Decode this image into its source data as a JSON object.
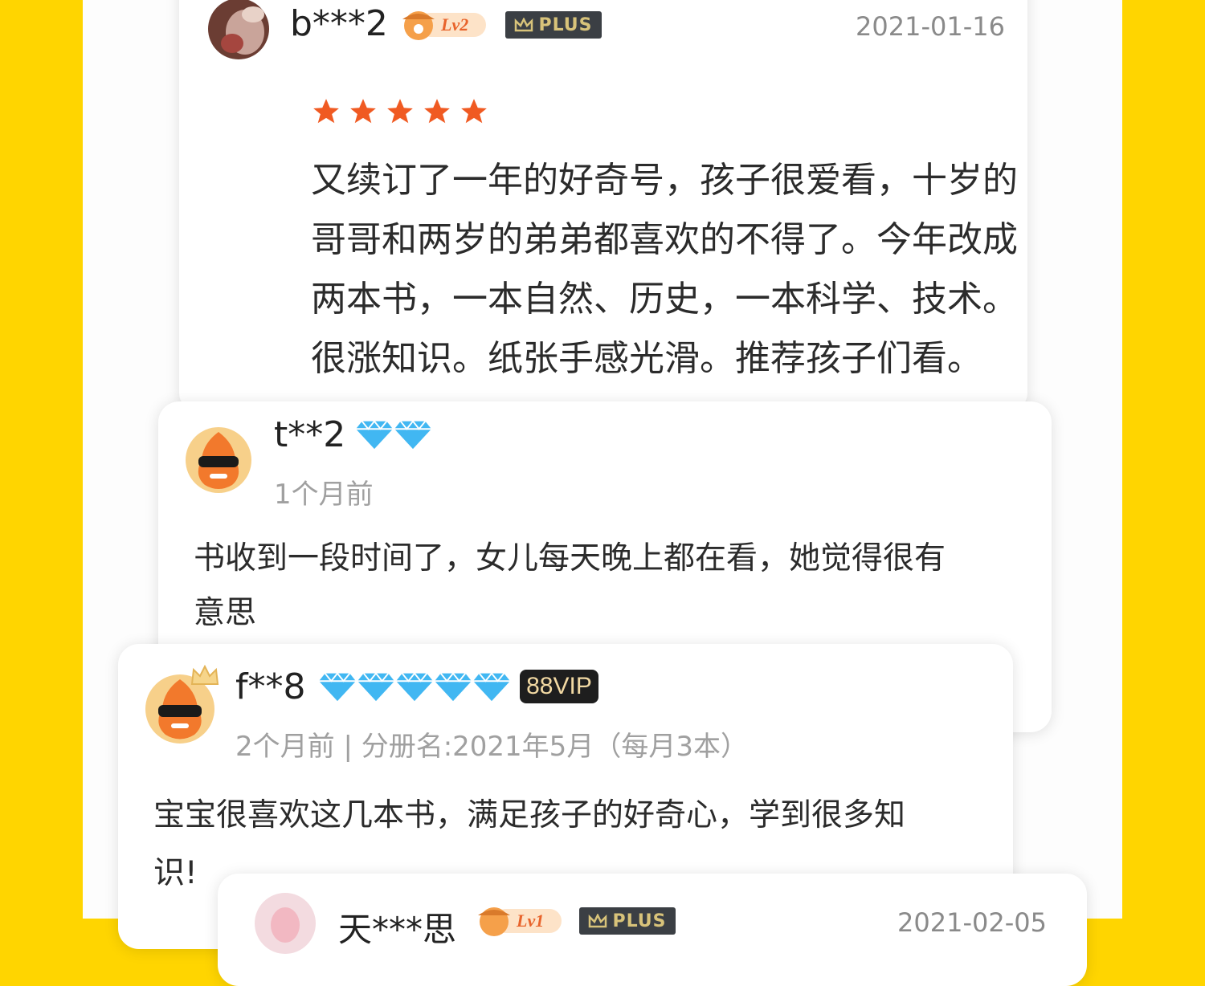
{
  "colors": {
    "background": "#FFD500",
    "star": "#F05A22",
    "diamond": "#41B7F2",
    "plus_badge": "#3B3F44",
    "vip_badge": "#1E1E1E"
  },
  "reviews": [
    {
      "username": "b***2",
      "level_badge": "Lv2",
      "plus_label": "PLUS",
      "date": "2021-01-16",
      "rating": 5,
      "lines": [
        "又续订了一年的好奇号，孩子很爱看，十岁的",
        "哥哥和两岁的弟弟都喜欢的不得了。今年改成",
        "两本书，一本自然、历史，一本科学、技术。",
        "很涨知识。纸张手感光滑。推荐孩子们看。"
      ]
    },
    {
      "username": "t**2",
      "diamond_count": 2,
      "time": "1个月前",
      "lines": [
        "书收到一段时间了，女儿每天晚上都在看，她觉得很有",
        "意思"
      ]
    },
    {
      "username": "f**8",
      "diamond_count": 5,
      "vip_label": "88VIP",
      "meta": "2个月前 | 分册名:2021年5月（每月3本）",
      "lines": [
        "宝宝很喜欢这几本书，满足孩子的好奇心，学到很多知",
        "识!"
      ]
    },
    {
      "username": "天***思",
      "level_badge": "Lv1",
      "plus_label": "PLUS",
      "date": "2021-02-05"
    }
  ]
}
